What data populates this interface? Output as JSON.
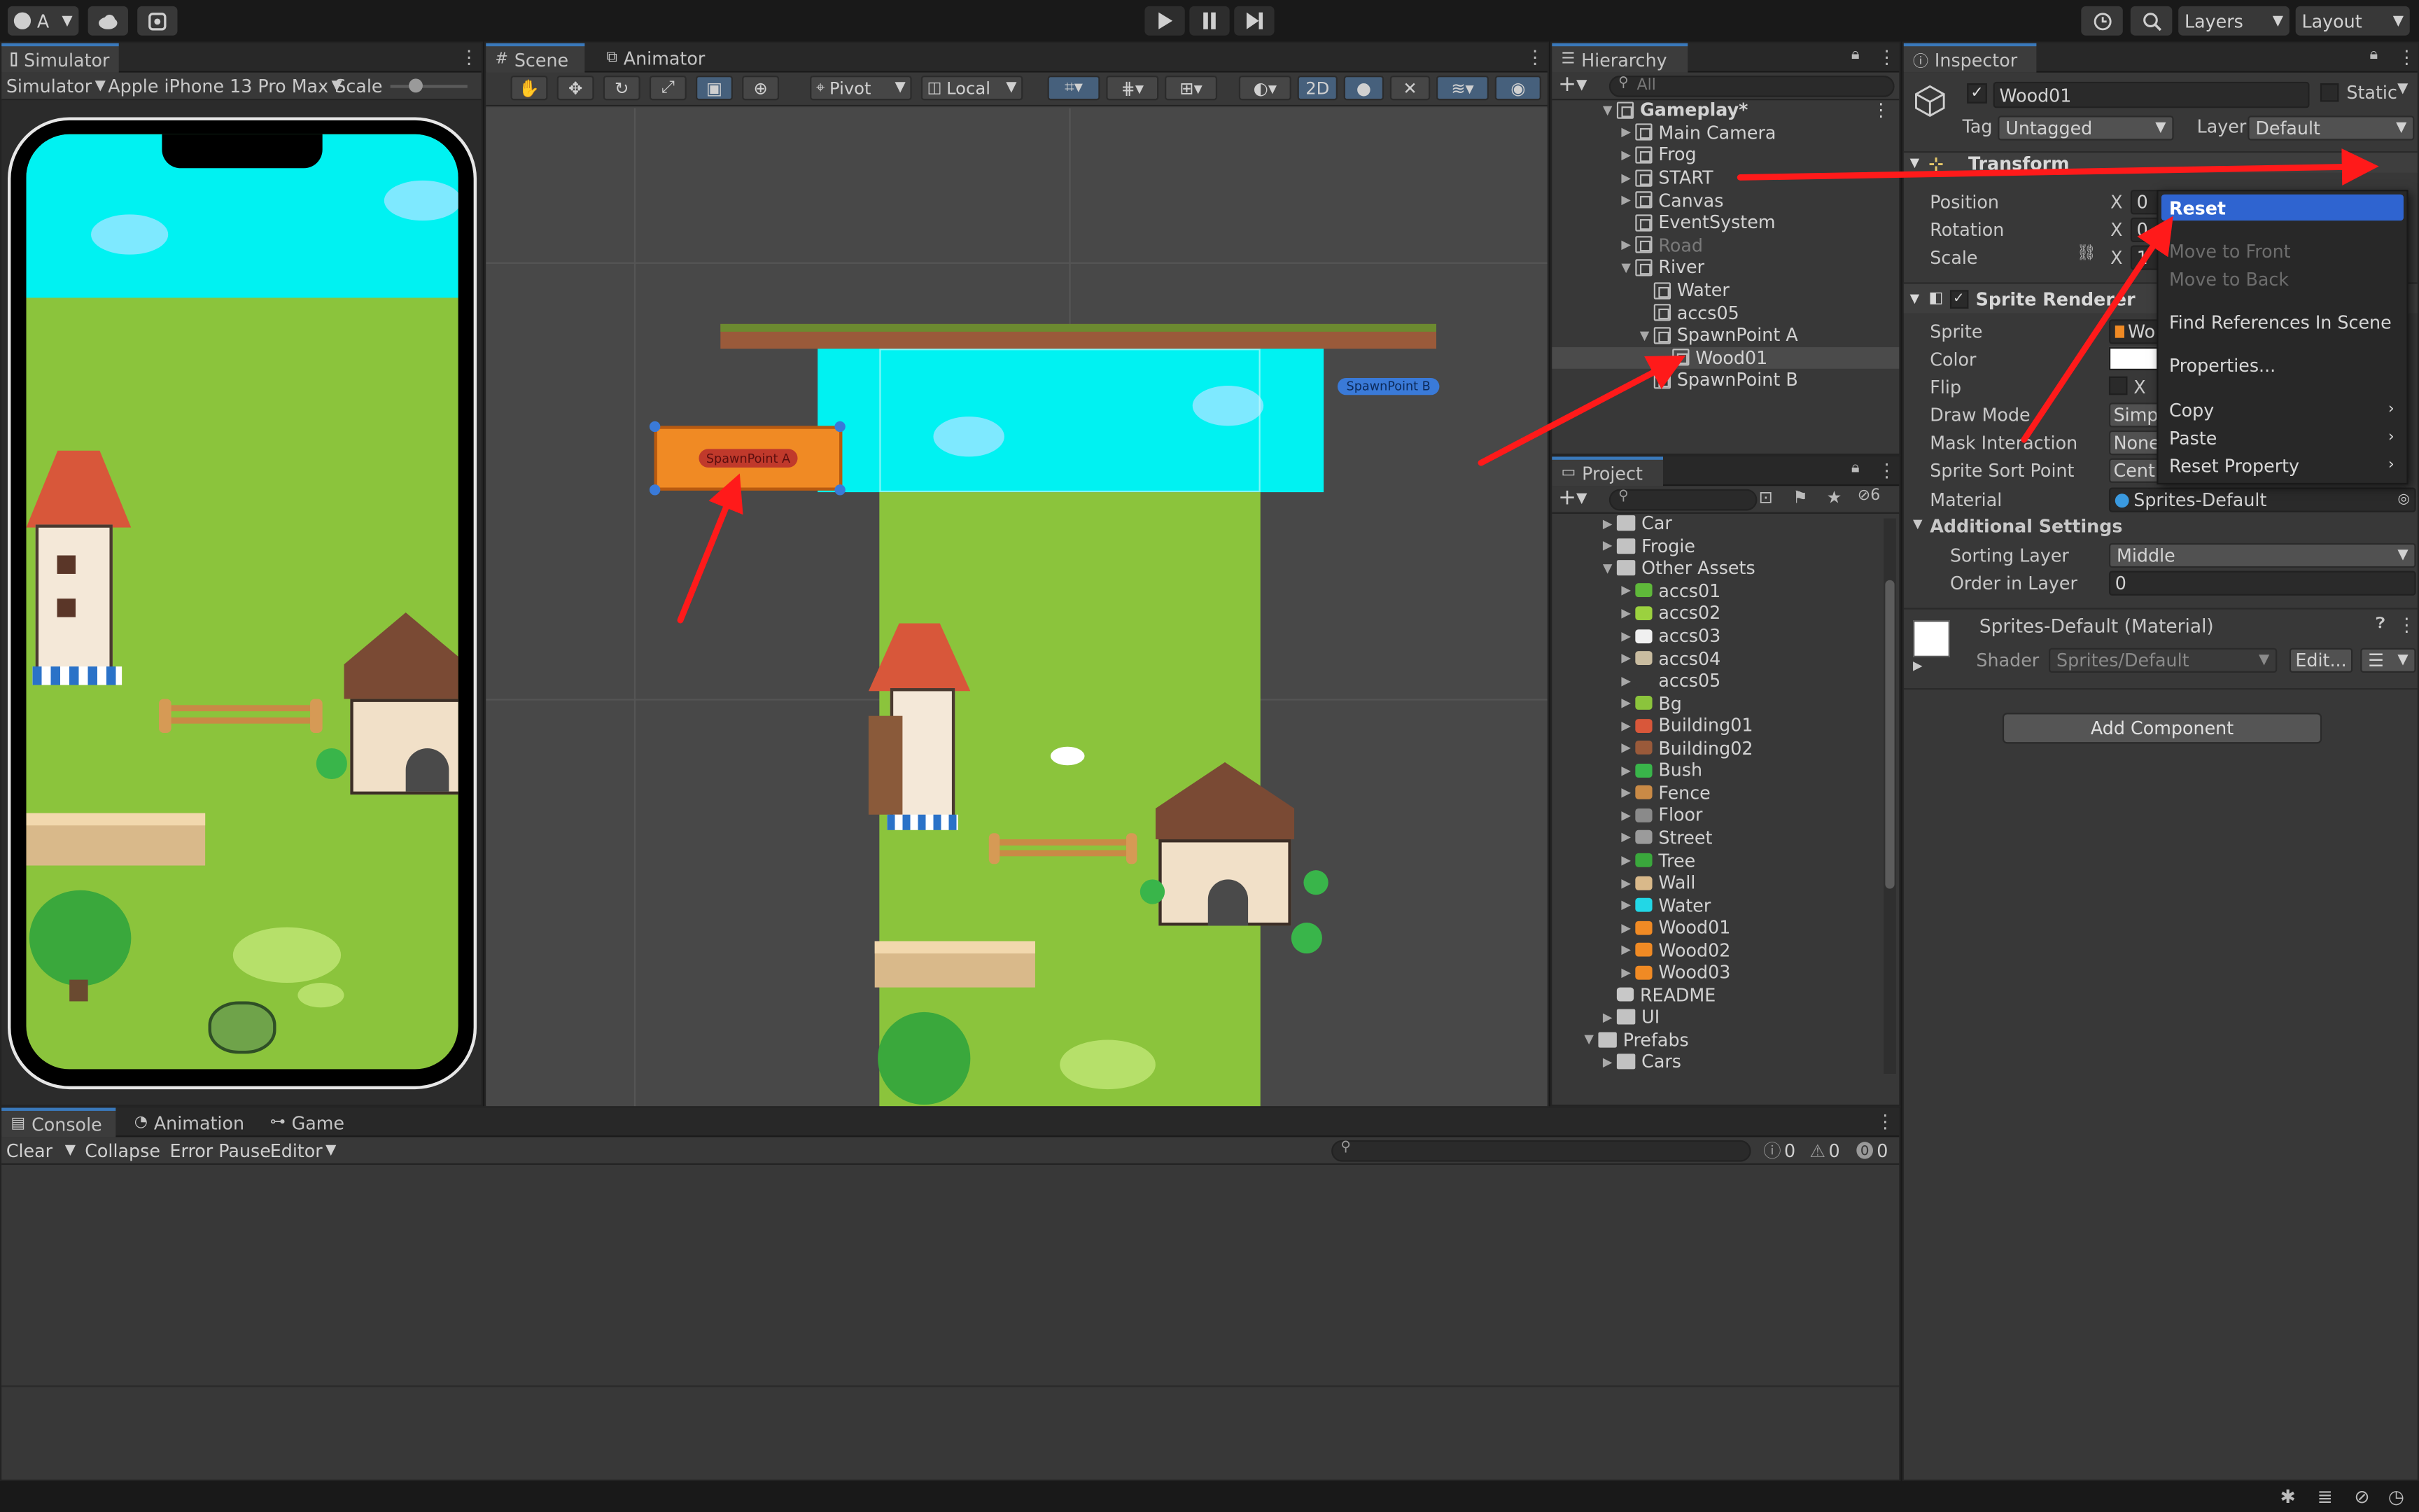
{
  "toolbar": {
    "account_label": "A",
    "layers_label": "Layers",
    "layout_label": "Layout"
  },
  "simulator": {
    "tab_label": "Simulator",
    "mode_label": "Simulator",
    "device_label": "Apple iPhone 13 Pro Max",
    "scale_label": "Scale"
  },
  "scene": {
    "tab_label": "Scene",
    "animator_tab_label": "Animator",
    "pivot_label": "Pivot",
    "local_label": "Local",
    "mode_2d_label": "2D",
    "spawn_a_label": "SpawnPoint A",
    "spawn_b_label": "SpawnPoint B"
  },
  "hierarchy": {
    "tab_label": "Hierarchy",
    "search_placeholder": "All",
    "items": [
      {
        "label": "Gameplay*",
        "depth": 0,
        "arrow": "▼",
        "kind": "scene"
      },
      {
        "label": "Main Camera",
        "depth": 1,
        "arrow": "▶",
        "kind": "go"
      },
      {
        "label": "Frog",
        "depth": 1,
        "arrow": "▶",
        "kind": "go"
      },
      {
        "label": "START",
        "depth": 1,
        "arrow": "▶",
        "kind": "go"
      },
      {
        "label": "Canvas",
        "depth": 1,
        "arrow": "▶",
        "kind": "go"
      },
      {
        "label": "EventSystem",
        "depth": 1,
        "arrow": "",
        "kind": "go"
      },
      {
        "label": "Road",
        "depth": 1,
        "arrow": "▶",
        "kind": "go",
        "dim": true
      },
      {
        "label": "River",
        "depth": 1,
        "arrow": "▼",
        "kind": "go"
      },
      {
        "label": "Water",
        "depth": 2,
        "arrow": "",
        "kind": "go"
      },
      {
        "label": "accs05",
        "depth": 2,
        "arrow": "",
        "kind": "go"
      },
      {
        "label": "SpawnPoint A",
        "depth": 2,
        "arrow": "▼",
        "kind": "go"
      },
      {
        "label": "Wood01",
        "depth": 3,
        "arrow": "",
        "kind": "go",
        "selected": true
      },
      {
        "label": "SpawnPoint B",
        "depth": 2,
        "arrow": "",
        "kind": "go"
      }
    ]
  },
  "project": {
    "tab_label": "Project",
    "hidden_count": "6",
    "items": [
      {
        "label": "Car",
        "depth": 1,
        "arrow": "▶",
        "icon": "folder"
      },
      {
        "label": "Frogie",
        "depth": 1,
        "arrow": "▶",
        "icon": "folder"
      },
      {
        "label": "Other Assets",
        "depth": 1,
        "arrow": "▼",
        "icon": "folder"
      },
      {
        "label": "accs01",
        "depth": 2,
        "arrow": "▶",
        "icon": "accs01",
        "color": "#5fb83a"
      },
      {
        "label": "accs02",
        "depth": 2,
        "arrow": "▶",
        "icon": "accs02",
        "color": "#9bd13f"
      },
      {
        "label": "accs03",
        "depth": 2,
        "arrow": "▶",
        "icon": "accs03",
        "color": "#f0f0f0"
      },
      {
        "label": "accs04",
        "depth": 2,
        "arrow": "▶",
        "icon": "accs04",
        "color": "#c9bca0"
      },
      {
        "label": "accs05",
        "depth": 2,
        "arrow": "▶",
        "icon": "accs05",
        "color": "#383838"
      },
      {
        "label": "Bg",
        "depth": 2,
        "arrow": "▶",
        "icon": "bg",
        "color": "#8bc43c"
      },
      {
        "label": "Building01",
        "depth": 2,
        "arrow": "▶",
        "icon": "building01",
        "color": "#d8573a"
      },
      {
        "label": "Building02",
        "depth": 2,
        "arrow": "▶",
        "icon": "building02",
        "color": "#9a5a3a"
      },
      {
        "label": "Bush",
        "depth": 2,
        "arrow": "▶",
        "icon": "bush",
        "color": "#39b54a"
      },
      {
        "label": "Fence",
        "depth": 2,
        "arrow": "▶",
        "icon": "fence",
        "color": "#c98a46"
      },
      {
        "label": "Floor",
        "depth": 2,
        "arrow": "▶",
        "icon": "floor",
        "color": "#8a8a8a"
      },
      {
        "label": "Street",
        "depth": 2,
        "arrow": "▶",
        "icon": "street",
        "color": "#9b9b9b"
      },
      {
        "label": "Tree",
        "depth": 2,
        "arrow": "▶",
        "icon": "tree",
        "color": "#3aa83c"
      },
      {
        "label": "Wall",
        "depth": 2,
        "arrow": "▶",
        "icon": "wall",
        "color": "#d9b98a"
      },
      {
        "label": "Water",
        "depth": 2,
        "arrow": "▶",
        "icon": "water",
        "color": "#22d7e6"
      },
      {
        "label": "Wood01",
        "depth": 2,
        "arrow": "▶",
        "icon": "wood01",
        "color": "#f08a24"
      },
      {
        "label": "Wood02",
        "depth": 2,
        "arrow": "▶",
        "icon": "wood02",
        "color": "#f08a24"
      },
      {
        "label": "Wood03",
        "depth": 2,
        "arrow": "▶",
        "icon": "wood03",
        "color": "#f08a24"
      },
      {
        "label": "README",
        "depth": 1,
        "arrow": "",
        "icon": "readme",
        "color": "#c8c8c8"
      },
      {
        "label": "UI",
        "depth": 1,
        "arrow": "▶",
        "icon": "folder"
      },
      {
        "label": "Prefabs",
        "depth": 0,
        "arrow": "▼",
        "icon": "folder"
      },
      {
        "label": "Cars",
        "depth": 1,
        "arrow": "▶",
        "icon": "folder"
      }
    ]
  },
  "inspector": {
    "tab_label": "Inspector",
    "object_name": "Wood01",
    "static_label": "Static",
    "tag_label": "Tag",
    "tag_value": "Untagged",
    "layer_label": "Layer",
    "layer_value": "Default",
    "transform_label": "Transform",
    "position_label": "Position",
    "rotation_label": "Rotation",
    "scale_label": "Scale",
    "x_label": "X",
    "position_x": "0",
    "rotation_x": "0",
    "scale_x": "1",
    "sprite_renderer_label": "Sprite Renderer",
    "sprite_label": "Sprite",
    "sprite_value": "Wo",
    "color_label": "Color",
    "flip_label": "Flip",
    "draw_mode_label": "Draw Mode",
    "draw_mode_value": "Simp",
    "mask_label": "Mask Interaction",
    "mask_value": "None",
    "sort_point_label": "Sprite Sort Point",
    "sort_point_value": "Cent",
    "material_label": "Material",
    "material_value": "Sprites-Default",
    "additional_label": "Additional Settings",
    "sorting_layer_label": "Sorting Layer",
    "sorting_layer_value": "Middle",
    "order_label": "Order in Layer",
    "order_value": "0",
    "material_asset_label": "Sprites-Default (Material)",
    "shader_label": "Shader",
    "shader_value": "Sprites/Default",
    "edit_label": "Edit...",
    "add_component_label": "Add Component"
  },
  "context_menu": {
    "items": [
      {
        "label": "Reset",
        "state": "selected"
      },
      {
        "label": "Move to Front",
        "state": "disabled"
      },
      {
        "label": "Move to Back",
        "state": "disabled"
      },
      {
        "label": "Find References In Scene",
        "state": "normal"
      },
      {
        "label": "Properties...",
        "state": "normal"
      },
      {
        "label": "Copy",
        "state": "submenu"
      },
      {
        "label": "Paste",
        "state": "submenu"
      },
      {
        "label": "Reset Property",
        "state": "submenu"
      }
    ]
  },
  "console": {
    "tab_label": "Console",
    "animation_tab_label": "Animation",
    "game_tab_label": "Game",
    "clear_label": "Clear",
    "collapse_label": "Collapse",
    "error_pause_label": "Error Pause",
    "editor_label": "Editor",
    "info_count": "0",
    "warning_count": "0",
    "error_count": "0"
  },
  "colors": {
    "accent": "#2f64d0",
    "annotation_arrow": "#ff1a1a",
    "water": "#00f2f2",
    "grass": "#8bc43c"
  }
}
